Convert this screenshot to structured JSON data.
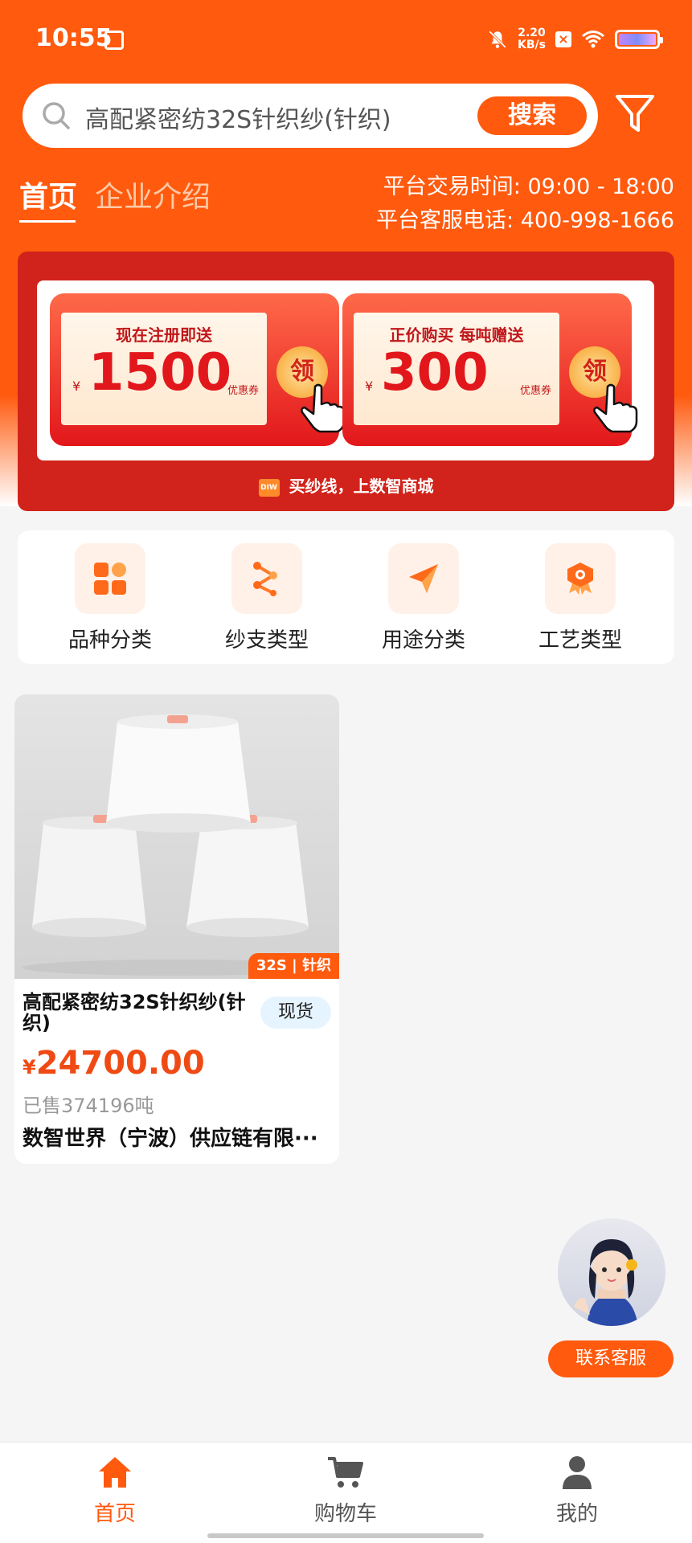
{
  "status_bar": {
    "time": "10:55",
    "net_speed_value": "2.20",
    "net_speed_unit": "KB/s"
  },
  "search": {
    "query": "高配紧密纺32S针织纱(针织)",
    "button_label": "搜索"
  },
  "tabs": [
    {
      "label": "首页",
      "active": true
    },
    {
      "label": "企业介绍",
      "active": false
    }
  ],
  "platform": {
    "trading_hours": "平台交易时间: 09:00 - 18:00",
    "service_phone": "平台客服电话: 400-998-1666"
  },
  "banner": {
    "coupons": [
      {
        "title": "现在注册即送",
        "yen": "¥",
        "amount": "1500",
        "unit": "优惠券",
        "claim": "领"
      },
      {
        "title": "正价购买 每吨赠送",
        "yen": "¥",
        "amount": "300",
        "unit": "优惠券",
        "claim": "领"
      }
    ],
    "logo_text": "DIW",
    "footer": "买纱线，上数智商城"
  },
  "categories": [
    {
      "label": "品种分类",
      "icon": "grid-icon"
    },
    {
      "label": "纱支类型",
      "icon": "branch-icon"
    },
    {
      "label": "用途分类",
      "icon": "send-icon"
    },
    {
      "label": "工艺类型",
      "icon": "badge-icon"
    }
  ],
  "products": [
    {
      "tag": "32S | 针织",
      "name": "高配紧密纺32S针织纱(针织)",
      "stock": "现货",
      "price_symbol": "¥",
      "price": "24700.00",
      "sold": "已售374196吨",
      "company": "数智世界（宁波）供应链有限···"
    }
  ],
  "customer_service": {
    "label": "联系客服"
  },
  "bottom_nav": [
    {
      "label": "首页",
      "active": true
    },
    {
      "label": "购物车",
      "active": false
    },
    {
      "label": "我的",
      "active": false
    }
  ],
  "colors": {
    "brand": "#ff5a0e",
    "banner_red": "#d1231b",
    "price": "#f04a14"
  }
}
